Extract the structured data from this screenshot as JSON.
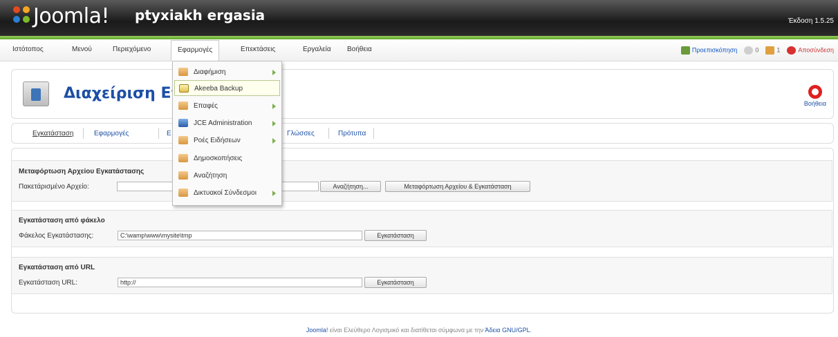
{
  "header": {
    "logo_text": "Joomla!",
    "site_name": "ptyxiakh ergasia",
    "version": "Έκδοση 1.5.25"
  },
  "menubar": {
    "items": [
      "Ιστότοπος",
      "Μενού",
      "Περιεχόμενο",
      "Εφαρμογές",
      "Επεκτάσεις",
      "Εργαλεία",
      "Βοήθεια"
    ],
    "active_index": 3
  },
  "status": {
    "preview": "Προεπισκόπηση",
    "messages_count": "0",
    "users_count": "1",
    "logout": "Αποσύνδεση"
  },
  "toolbar": {
    "title": "Διαχείριση Επ",
    "help_label": "Βοήθεια"
  },
  "tabs": [
    "Εγκατάσταση",
    "Εφαρμογές",
    "Ε",
    "Γλώσσες",
    "Πρότυπα"
  ],
  "dropdown": {
    "items": [
      {
        "label": "Διαφήμιση",
        "icon": "folder-icon",
        "submenu": true
      },
      {
        "label": "Akeeba Backup",
        "icon": "akeeba-icon",
        "submenu": false
      },
      {
        "label": "Επαφές",
        "icon": "folder-icon",
        "submenu": true
      },
      {
        "label": "JCE Administration",
        "icon": "jce-icon",
        "submenu": true
      },
      {
        "label": "Ροές Ειδήσεων",
        "icon": "folder-icon",
        "submenu": true
      },
      {
        "label": "Δημοσκοπήσεις",
        "icon": "folder-icon",
        "submenu": false
      },
      {
        "label": "Αναζήτηση",
        "icon": "folder-icon",
        "submenu": false
      },
      {
        "label": "Δικτυακοί Σύνδεσμοι",
        "icon": "folder-icon",
        "submenu": true
      }
    ],
    "highlighted_index": 1
  },
  "upload": {
    "title": "Μεταφόρτωση Αρχείου Εγκατάστασης",
    "label": "Πακετάρισμένο Αρχείο:",
    "value": "",
    "browse_button": "Αναζήτηση...",
    "submit_button": "Μεταφόρτωση Αρχείου & Εγκατάσταση"
  },
  "folder": {
    "title": "Εγκατάσταση από φάκελο",
    "label": "Φάκελος Εγκατάστασης:",
    "value": "C:\\wamp\\www\\mysite\\tmp",
    "button": "Εγκατάσταση"
  },
  "url": {
    "title": "Εγκατάσταση από URL",
    "label": "Εγκατάσταση URL:",
    "value": "http://",
    "button": "Εγκατάσταση"
  },
  "footer": {
    "link1": "Joomla!",
    "text": " είναι Ελεύθερο Λογισμικό και διατίθεται σύμφωνα με την ",
    "link2": "Άδεια GNU/GPL",
    "end": "."
  }
}
